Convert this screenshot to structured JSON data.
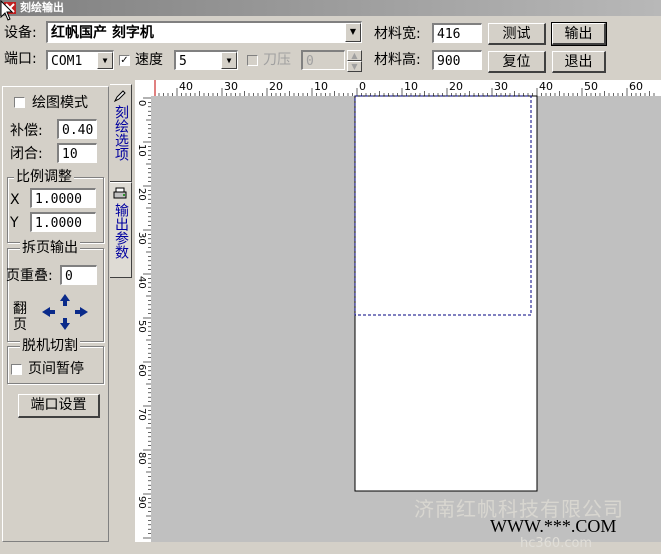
{
  "window": {
    "title": "刻绘输出"
  },
  "toolbar": {
    "device_label": "设备:",
    "device_value": "红帆国产  刻字机",
    "port_label": "端口:",
    "port_value": "COM1",
    "speed_label": "速度",
    "speed_value": "5",
    "pressure_label": "刀压",
    "pressure_value": "0",
    "width_label": "材料宽:",
    "width_value": "416",
    "height_label": "材料高:",
    "height_value": "900",
    "test_button": "测试",
    "output_button": "输出",
    "reset_button": "复位",
    "exit_button": "退出",
    "speed_checked": true,
    "pressure_checked": false
  },
  "left_panel": {
    "plot_mode_label": "绘图模式",
    "plot_mode_checked": false,
    "compensation_label": "补偿:",
    "compensation_value": "0.40",
    "closure_label": "闭合:",
    "closure_value": "10",
    "scale_group_title": "比例调整",
    "x_label": "X",
    "x_value": "1.0000",
    "y_label": "Y",
    "y_value": "1.0000",
    "paging_group_title": "拆页输出",
    "overlap_label": "页重叠:",
    "overlap_value": "0",
    "flip_label": "翻页",
    "offline_group_title": "脱机切割",
    "page_pause_label": "页间暂停",
    "page_pause_checked": false,
    "port_settings_button": "端口设置"
  },
  "tabs": [
    {
      "label": "刻绘选项"
    },
    {
      "label": "输出参数"
    }
  ],
  "ruler": {
    "h_labels": [
      "40",
      "30",
      "20",
      "10",
      "0",
      "10",
      "20",
      "30",
      "40",
      "50",
      "60"
    ],
    "v_labels": [
      "0",
      "10",
      "20",
      "30",
      "40",
      "50",
      "60",
      "70",
      "80",
      "90"
    ]
  },
  "watermark": {
    "company": "济南红帆科技有限公司",
    "site": "WWW.***.COM",
    "faint": "hc360.com"
  },
  "colors": {
    "tab_text": "#0000a0",
    "arrow": "#0a2a8a",
    "ruler_mark": "#c00000"
  }
}
